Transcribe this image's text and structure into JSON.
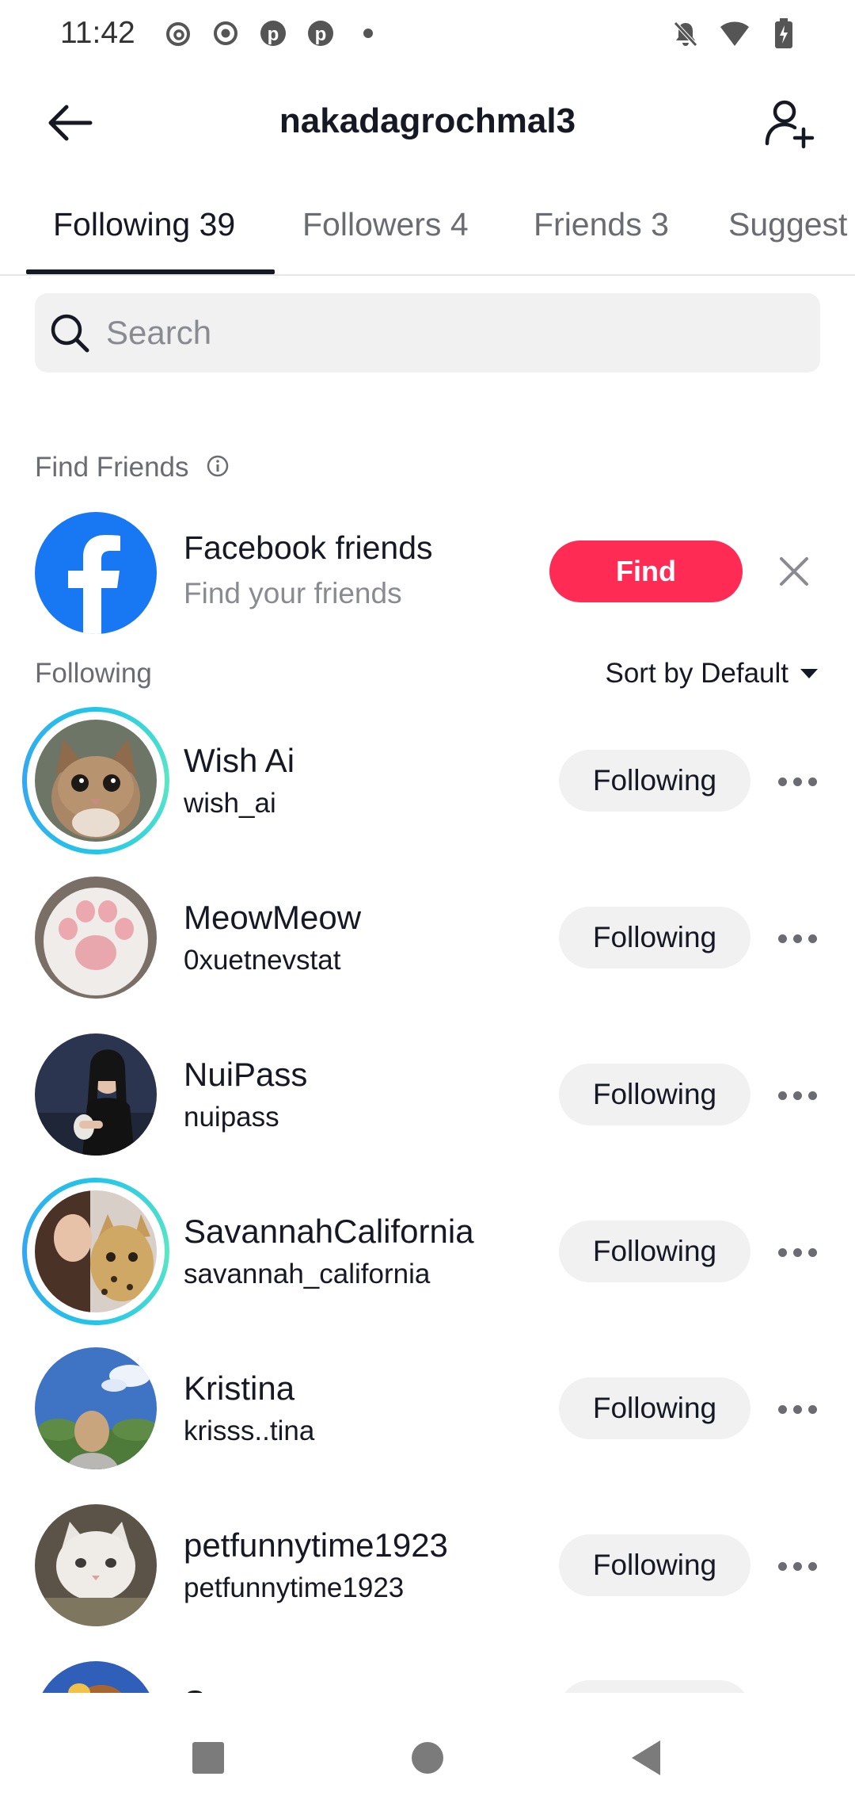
{
  "status_bar": {
    "time": "11:42",
    "left_icons": [
      "threads-icon",
      "record-icon",
      "pinterest-icon",
      "pinterest-icon",
      "dot-icon"
    ],
    "right_icons": [
      "bell-off-icon",
      "wifi-icon",
      "battery-charging-icon"
    ]
  },
  "header": {
    "title": "nakadagrochmal3",
    "back_icon": "arrow-left-icon",
    "add_user_icon": "add-user-icon"
  },
  "tabs": [
    {
      "label": "Following 39",
      "active": true
    },
    {
      "label": "Followers 4",
      "active": false
    },
    {
      "label": "Friends 3",
      "active": false
    },
    {
      "label": "Suggest",
      "active": false
    }
  ],
  "search": {
    "placeholder": "Search",
    "value": ""
  },
  "find_friends": {
    "section_label": "Find Friends",
    "name": "Facebook friends",
    "subtitle": "Find your friends",
    "button_label": "Find"
  },
  "following_section": {
    "label": "Following",
    "sort_label": "Sort by Default"
  },
  "users": [
    {
      "name": "Wish Ai",
      "handle": "wish_ai",
      "button": "Following",
      "has_story_ring": true
    },
    {
      "name": "MeowMeow",
      "handle": "0xuetnevstat",
      "button": "Following",
      "has_story_ring": false
    },
    {
      "name": "NuiPass",
      "handle": "nuipass",
      "button": "Following",
      "has_story_ring": false
    },
    {
      "name": "SavannahCalifornia",
      "handle": "savannah_california",
      "button": "Following",
      "has_story_ring": true
    },
    {
      "name": "Kristina",
      "handle": "krisss..tina",
      "button": "Following",
      "has_story_ring": false
    },
    {
      "name": "petfunnytime1923",
      "handle": "petfunnytime1923",
      "button": "Following",
      "has_story_ring": false
    },
    {
      "name": "S",
      "handle": "",
      "button": "",
      "has_story_ring": false
    }
  ],
  "colors": {
    "accent": "#fe2c55",
    "facebook": "#1877f2",
    "text": "#161823",
    "muted": "#8a8b91",
    "chip_bg": "#f1f1f2"
  }
}
